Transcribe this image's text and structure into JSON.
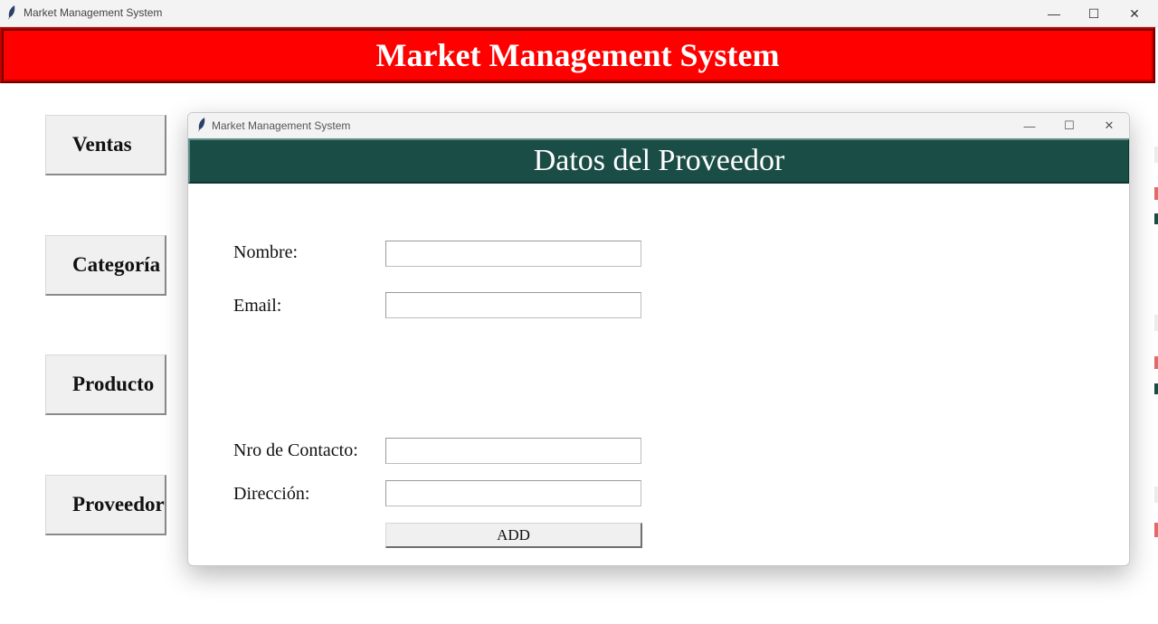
{
  "window": {
    "title": "Market Management System",
    "controls": {
      "minimize": "—",
      "maximize": "☐",
      "close": "✕"
    }
  },
  "header": {
    "title": "Market Management System",
    "bg_color": "#ff0000"
  },
  "sidebar": {
    "items": [
      {
        "label": "Ventas"
      },
      {
        "label": "Categoría"
      },
      {
        "label": "Producto"
      },
      {
        "label": "Proveedor"
      }
    ]
  },
  "dialog": {
    "title": "Market Management System",
    "header": "Datos del Proveedor",
    "header_color": "#1b4d47",
    "fields": {
      "nombre": {
        "label": "Nombre:",
        "value": ""
      },
      "email": {
        "label": "Email:",
        "value": ""
      },
      "contacto": {
        "label": "Nro de Contacto:",
        "value": ""
      },
      "direccion": {
        "label": "Dirección:",
        "value": ""
      }
    },
    "add_label": "ADD"
  }
}
